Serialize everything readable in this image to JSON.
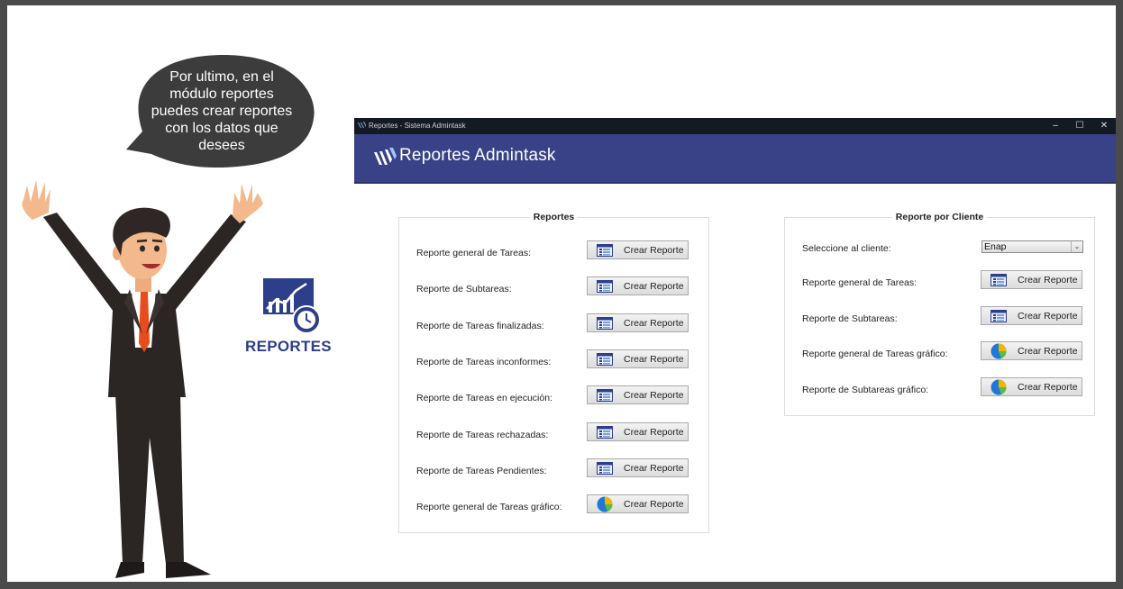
{
  "bubble": {
    "text": "Por ultimo, en el\nmódulo reportes\npuedes crear reportes\ncon los datos que\ndesees"
  },
  "module": {
    "label": "REPORTES"
  },
  "window": {
    "title": "Reportes - Sistema Admintask",
    "controls": {
      "minimize": "–",
      "maximize": "☐",
      "close": "✕"
    }
  },
  "header": {
    "title": "Reportes Admintask"
  },
  "reportes": {
    "title": "Reportes",
    "rows": [
      {
        "label": "Reporte general de Tareas:",
        "button": "Crear Reporte",
        "icon": "spreadsheet-icon"
      },
      {
        "label": "Reporte de Subtareas:",
        "button": "Crear Reporte",
        "icon": "spreadsheet-icon"
      },
      {
        "label": "Reporte de Tareas finalizadas:",
        "button": "Crear Reporte",
        "icon": "spreadsheet-icon"
      },
      {
        "label": "Reporte de Tareas inconformes:",
        "button": "Crear Reporte",
        "icon": "spreadsheet-icon"
      },
      {
        "label": "Reporte de Tareas en ejecución:",
        "button": "Crear Reporte",
        "icon": "spreadsheet-icon"
      },
      {
        "label": "Reporte de Tareas rechazadas:",
        "button": "Crear Reporte",
        "icon": "spreadsheet-icon"
      },
      {
        "label": "Reporte de Tareas Pendientes:",
        "button": "Crear Reporte",
        "icon": "spreadsheet-icon"
      },
      {
        "label": "Reporte general de Tareas gráfico:",
        "button": "Crear Reporte",
        "icon": "pie-chart-icon"
      }
    ]
  },
  "cliente": {
    "title": "Reporte por Cliente",
    "select_label": "Seleccione al cliente:",
    "select_value": "Enap",
    "rows": [
      {
        "label": "Reporte general de Tareas:",
        "button": "Crear Reporte",
        "icon": "spreadsheet-icon"
      },
      {
        "label": "Reporte de Subtareas:",
        "button": "Crear Reporte",
        "icon": "spreadsheet-icon"
      },
      {
        "label": "Reporte general de Tareas gráfico:",
        "button": "Crear Reporte",
        "icon": "pie-chart-icon"
      },
      {
        "label": "Reporte de Subtareas gráfico:",
        "button": "Crear Reporte",
        "icon": "pie-chart-icon"
      }
    ]
  },
  "colors": {
    "header_bg": "#394287",
    "titlebar_bg": "#141a24",
    "bubble_bg": "#3c3c3c",
    "module_blue": "#2d3e8a"
  }
}
